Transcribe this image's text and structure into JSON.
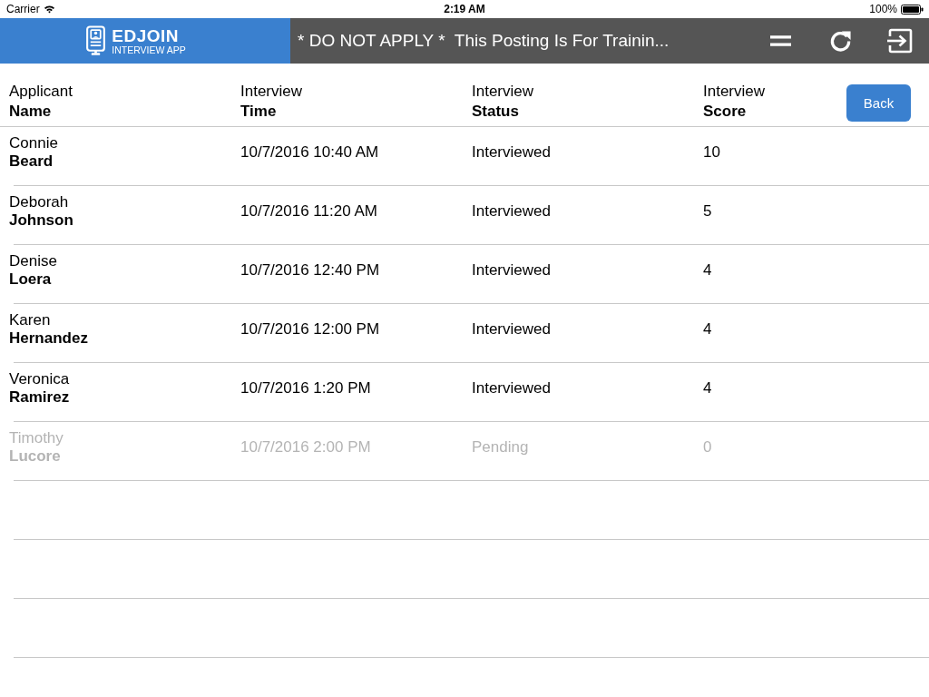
{
  "status_bar": {
    "carrier": "Carrier",
    "time": "2:19 AM",
    "battery": "100%"
  },
  "nav_bar": {
    "logo": {
      "name": "EDJOIN",
      "subtitle": "INTERVIEW APP"
    },
    "title": "* DO NOT APPLY *  This Posting Is For Trainin..."
  },
  "table": {
    "columns": [
      {
        "top": "Applicant",
        "bottom": "Name"
      },
      {
        "top": "Interview",
        "bottom": "Time"
      },
      {
        "top": "Interview",
        "bottom": "Status"
      },
      {
        "top": "Interview",
        "bottom": "Score"
      }
    ],
    "back_button": "Back",
    "rows": [
      {
        "first_name": "Connie",
        "last_name": "Beard",
        "time": "10/7/2016 10:40 AM",
        "status": "Interviewed",
        "score": "10",
        "disabled": false
      },
      {
        "first_name": "Deborah",
        "last_name": "Johnson",
        "time": "10/7/2016 11:20 AM",
        "status": "Interviewed",
        "score": "5",
        "disabled": false
      },
      {
        "first_name": "Denise",
        "last_name": "Loera",
        "time": "10/7/2016 12:40 PM",
        "status": "Interviewed",
        "score": "4",
        "disabled": false
      },
      {
        "first_name": "Karen",
        "last_name": "Hernandez",
        "time": "10/7/2016 12:00 PM",
        "status": "Interviewed",
        "score": "4",
        "disabled": false
      },
      {
        "first_name": "Veronica",
        "last_name": "Ramirez",
        "time": "10/7/2016 1:20 PM",
        "status": "Interviewed",
        "score": "4",
        "disabled": false
      },
      {
        "first_name": "Timothy",
        "last_name": "Lucore",
        "time": "10/7/2016 2:00 PM",
        "status": "Pending",
        "score": "0",
        "disabled": true
      }
    ]
  }
}
